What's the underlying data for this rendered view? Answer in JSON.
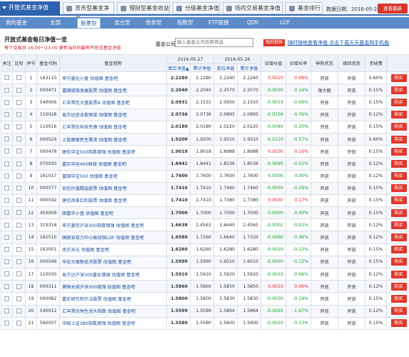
{
  "tabs": {
    "active": "开放式基金净值",
    "items": [
      "货币型基金净值",
      "理财型基金收益",
      "分级基金净值",
      "场内交易基金净值",
      "基金排行"
    ]
  },
  "date_label": "数据日期：2016-05-27",
  "latest_button": "查看最新",
  "subnav": {
    "my_funds": "我的基金",
    "items": [
      "全部",
      "股票型",
      "混合型",
      "债券型",
      "指数型",
      "ETF联接",
      "QDII",
      "LOF"
    ],
    "active_index": 1
  },
  "page_title": "开放式基金每日净值一览",
  "notice": "每个交易日 16:00～23:00 更新当日的最新开放式基金净值",
  "company_label": "基金公司：",
  "company_placeholder": "输入基金公司名称筛选",
  "notice_badge": "强烈推荐",
  "promo_link": "随时随地查看净值 点击下载天天基金网手机版",
  "radios": {
    "purchasable": "可购",
    "all": "全部",
    "selected": "all"
  },
  "table": {
    "headers": {
      "follow": "关注",
      "compare": "比较",
      "seq": "序号",
      "code": "基金代码",
      "name": "基金简称",
      "date1": "2016-05-27",
      "date2": "2016-05-26",
      "unit_nav": "单位净值",
      "acc_nav": "累计净值",
      "daily_growth": "日增长值",
      "daily_rate": "日增长率",
      "purchase_status": "申购状态",
      "redeem_status": "赎回状态",
      "fee": "手续费",
      "sort_mark": "▲"
    },
    "rows": [
      {
        "seq": "1",
        "code": "163110",
        "name": "申万量化小盘 估值图 基金吧",
        "unit1": "2.2280",
        "acc1": "2.2280",
        "unit2": "2.2260",
        "acc2": "2.2260",
        "growth": "0.0020",
        "rate": "0.09%",
        "dir": "up",
        "purchase": "开放",
        "redeem": "开放",
        "fee": "0.60%",
        "buy": "购买"
      },
      {
        "seq": "2",
        "code": "000471",
        "name": "富国城镇发展股票 估值图 基金吧",
        "unit1": "2.2040",
        "acc1": "2.2040",
        "unit2": "2.2070",
        "acc2": "2.2070",
        "growth": "-0.0030",
        "rate": "-0.14%",
        "dir": "dn",
        "purchase": "限大额",
        "redeem": "开放",
        "fee": "0.15%",
        "buy": "购买"
      },
      {
        "seq": "3",
        "code": "540006",
        "name": "汇丰晋信大盘股票A 估值图 基金吧",
        "unit1": "2.0931",
        "acc1": "2.1531",
        "unit2": "2.0950",
        "acc2": "2.1550",
        "growth": "-0.0019",
        "rate": "-0.09%",
        "dir": "dn",
        "purchase": "开放",
        "redeem": "开放",
        "fee": "0.15%",
        "buy": "购买"
      },
      {
        "seq": "4",
        "code": "110028",
        "name": "易方达创业板联接 估值图 基金吧",
        "unit1": "2.0736",
        "acc1": "2.0736",
        "unit2": "2.0895",
        "acc2": "2.0895",
        "growth": "-0.0159",
        "rate": "-0.76%",
        "dir": "dn",
        "purchase": "开放",
        "redeem": "开放",
        "fee": "0.12%",
        "buy": "购买"
      },
      {
        "seq": "5",
        "code": "110016",
        "name": "汇丰晋信科技先锋 估值图 基金吧",
        "unit1": "2.0180",
        "acc1": "2.0180",
        "unit2": "2.0220",
        "acc2": "2.0220",
        "growth": "-0.0040",
        "rate": "-0.20%",
        "dir": "dn",
        "purchase": "开放",
        "redeem": "开放",
        "fee": "0.15%",
        "buy": "购买"
      },
      {
        "seq": "6",
        "code": "000524",
        "name": "上投摩根民生需求 估值图 基金吧",
        "unit1": "1.9200",
        "acc1": "1.9200",
        "unit2": "1.9310",
        "acc2": "1.9310",
        "growth": "-0.0110",
        "rate": "-0.57%",
        "dir": "dn",
        "purchase": "开放",
        "redeem": "开放",
        "fee": "0.60%",
        "buy": "购买"
      },
      {
        "seq": "7",
        "code": "000478",
        "name": "建信中证500指数增强 估值图 基金吧",
        "unit1": "1.9018",
        "acc1": "1.9018",
        "unit2": "1.8988",
        "acc2": "1.8988",
        "growth": "0.0030",
        "rate": "0.16%",
        "dir": "up",
        "purchase": "开放",
        "redeem": "开放",
        "fee": "0.15%",
        "buy": "购买"
      },
      {
        "seq": "8",
        "code": "070030",
        "name": "嘉实中创400联接 估值图 基金吧",
        "unit1": "1.8441",
        "acc1": "1.8441",
        "unit2": "1.8536",
        "acc2": "1.8536",
        "growth": "-0.0095",
        "rate": "-0.51%",
        "dir": "dn",
        "purchase": "开放",
        "redeem": "开放",
        "fee": "0.12%",
        "buy": "购买"
      },
      {
        "seq": "9",
        "code": "161017",
        "name": "富国中证500 估值图 基金吧",
        "unit1": "1.7600",
        "acc1": "1.7600",
        "unit2": "1.7600",
        "acc2": "1.7600",
        "growth": "0.0000",
        "rate": "0.00%",
        "dir": "dn",
        "purchase": "开放",
        "redeem": "开放",
        "fee": "0.12%",
        "buy": "购买"
      },
      {
        "seq": "10",
        "code": "000577",
        "name": "安信价值精选股票 估值图 基金吧",
        "unit1": "1.7410",
        "acc1": "1.7410",
        "unit2": "1.7460",
        "acc2": "1.7460",
        "growth": "-0.0050",
        "rate": "-0.29%",
        "dir": "dn",
        "purchase": "开放",
        "redeem": "开放",
        "fee": "0.15%",
        "buy": "购买"
      },
      {
        "seq": "11",
        "code": "000592",
        "name": "建信改革红利股票 估值图 基金吧",
        "unit1": "1.7410",
        "acc1": "1.7410",
        "unit2": "1.7380",
        "acc2": "1.7380",
        "growth": "0.0030",
        "rate": "0.17%",
        "dir": "up",
        "purchase": "开放",
        "redeem": "开放",
        "fee": "0.15%",
        "buy": "购买"
      },
      {
        "seq": "12",
        "code": "450009",
        "name": "国富中小盘 估值图 基金吧",
        "unit1": "1.7000",
        "acc1": "1.7000",
        "unit2": "1.7000",
        "acc2": "1.7000",
        "growth": "0.0000",
        "rate": "0.00%",
        "dir": "dn",
        "purchase": "开放",
        "redeem": "开放",
        "fee": "0.15%",
        "buy": "购买"
      },
      {
        "seq": "13",
        "code": "310318",
        "name": "申万菱信沪深300指数增强 估值图 基金吧",
        "unit1": "1.6638",
        "acc1": "2.4563",
        "unit2": "1.6640",
        "acc2": "2.4565",
        "growth": "-0.0002",
        "rate": "-0.01%",
        "dir": "dn",
        "purchase": "开放",
        "redeem": "开放",
        "fee": "0.12%",
        "buy": "购买"
      },
      {
        "seq": "14",
        "code": "162510",
        "name": "国联安双力中小板综指LOF 估值图 基金吧",
        "unit1": "1.6580",
        "acc1": "1.7260",
        "unit2": "1.6640",
        "acc2": "1.7320",
        "growth": "-0.0060",
        "rate": "-0.36%",
        "dir": "dn",
        "purchase": "开放",
        "redeem": "开放",
        "fee": "0.12%",
        "buy": "购买"
      },
      {
        "seq": "15",
        "code": "163001",
        "name": "南方天元 估值图 基金吧",
        "unit1": "1.6260",
        "acc1": "1.6260",
        "unit2": "1.6280",
        "acc2": "1.6280",
        "growth": "-0.0020",
        "rate": "-0.12%",
        "dir": "dn",
        "purchase": "开放",
        "redeem": "开放",
        "fee": "0.15%",
        "buy": "购买"
      },
      {
        "seq": "16",
        "code": "000549",
        "name": "华安大国新经济股票 估值图 基金吧",
        "unit1": "1.5990",
        "acc1": "1.5990",
        "unit2": "1.6010",
        "acc2": "1.6010",
        "growth": "-0.0020",
        "rate": "-0.12%",
        "dir": "dn",
        "purchase": "开放",
        "redeem": "开放",
        "fee": "0.15%",
        "buy": "购买"
      },
      {
        "seq": "17",
        "code": "110030",
        "name": "易方达沪深300量化增强 估值图 基金吧",
        "unit1": "1.5910",
        "acc1": "1.5910",
        "unit2": "1.5920",
        "acc2": "1.5920",
        "growth": "-0.0010",
        "rate": "-0.06%",
        "dir": "dn",
        "purchase": "开放",
        "redeem": "开放",
        "fee": "0.12%",
        "buy": "购买"
      },
      {
        "seq": "18",
        "code": "000311",
        "name": "景顺长城沪深300增强 估值图 基金吧",
        "unit1": "1.5860",
        "acc1": "1.5860",
        "unit2": "1.5850",
        "acc2": "1.5850",
        "growth": "0.0010",
        "rate": "0.06%",
        "dir": "up",
        "purchase": "开放",
        "redeem": "开放",
        "fee": "0.12%",
        "buy": "购买"
      },
      {
        "seq": "19",
        "code": "000082",
        "name": "嘉实研究阿尔法股票 估值图 基金吧",
        "unit1": "1.5800",
        "acc1": "1.5800",
        "unit2": "1.5830",
        "acc2": "1.5830",
        "growth": "-0.0030",
        "rate": "-0.19%",
        "dir": "dn",
        "purchase": "开放",
        "redeem": "开放",
        "fee": "0.15%",
        "buy": "购买"
      },
      {
        "seq": "20",
        "code": "540012",
        "name": "汇丰晋信恒生龙头指数 估值图 基金吧",
        "unit1": "1.5599",
        "acc1": "1.5599",
        "unit2": "1.5864",
        "acc2": "1.5864",
        "growth": "-0.0265",
        "rate": "-1.67%",
        "dir": "dn",
        "purchase": "开放",
        "redeem": "开放",
        "fee": "0.12%",
        "buy": "购买"
      },
      {
        "seq": "21",
        "code": "590007",
        "name": "中邮上证380指数增强 估值图 基金吧",
        "unit1": "1.5580",
        "acc1": "1.5580",
        "unit2": "1.5600",
        "acc2": "1.5600",
        "growth": "-0.0020",
        "rate": "-0.13%",
        "dir": "dn",
        "purchase": "开放",
        "redeem": "开放",
        "fee": "0.15%",
        "buy": "购买"
      }
    ]
  },
  "colors": {
    "tab_blue": "#2f62ad",
    "subnav_blue": "#5b8bc9",
    "up_red": "#e02020",
    "down_green": "#189a2c",
    "buy_red": "#e0382c"
  }
}
